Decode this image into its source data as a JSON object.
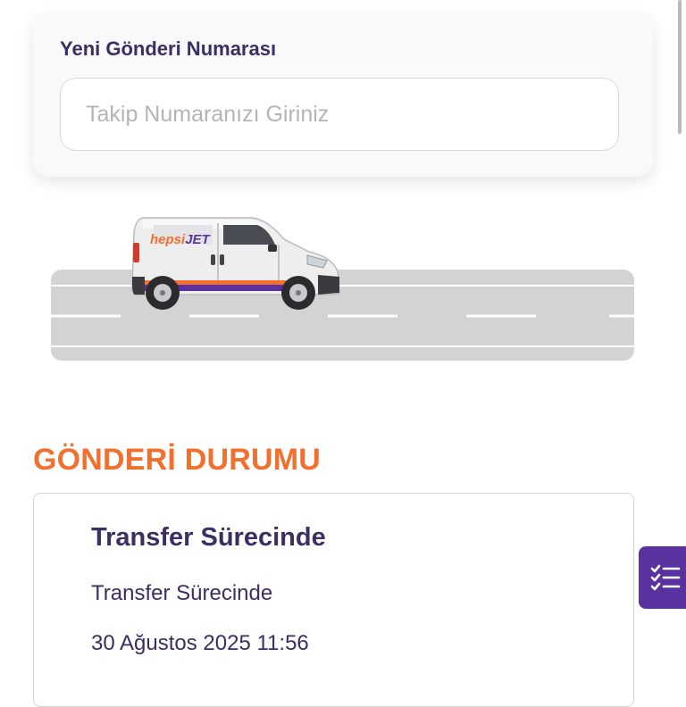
{
  "tracking": {
    "label": "Yeni Gönderi Numarası",
    "input_placeholder": "Takip Numaranızı Giriniz",
    "input_value": ""
  },
  "van": {
    "logo_prefix": "hepsi",
    "logo_suffix": "JET",
    "icon": "delivery-van-illustration"
  },
  "status_section": {
    "title": "GÖNDERİ DURUMU",
    "current": {
      "title": "Transfer Sürecinde",
      "description": "Transfer Sürecinde",
      "date": "30 Ağustos 2025 11:56"
    }
  },
  "floating_button": {
    "icon": "checklist-icon"
  },
  "colors": {
    "primary_purple": "#3a2e63",
    "accent_orange": "#f2702e",
    "button_purple": "#5a32a0",
    "road_gray": "#d3d3d3"
  }
}
